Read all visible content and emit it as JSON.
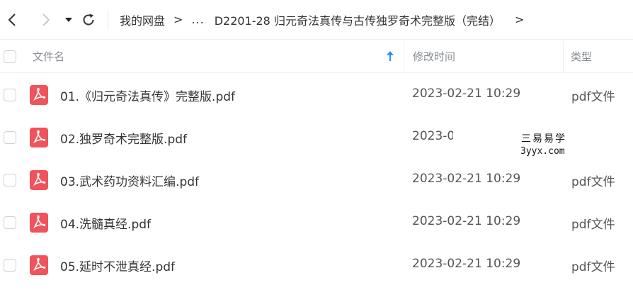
{
  "navbar": {
    "breadcrumb": {
      "root": "我的网盘",
      "separator": ">",
      "ellipsis": "...",
      "current": "D2201-28 归元奇法真传与古传独罗奇术完整版（完结）"
    },
    "icons": [
      "chevron-left-icon",
      "chevron-right-icon",
      "caret-down-icon",
      "refresh-icon"
    ]
  },
  "header": {
    "name": "文件名",
    "time": "修改时间",
    "type": "类型",
    "sort_icon": "arrow-up-icon"
  },
  "files": [
    {
      "name": "01.《归元奇法真传》完整版.pdf",
      "time": "2023-02-21 10:29",
      "type": "pdf文件"
    },
    {
      "name": "02.独罗奇术完整版.pdf",
      "time": "2023-0",
      "type": ""
    },
    {
      "name": "03.武术药功资料汇编.pdf",
      "time": "2023-02-21 10:29",
      "type": "pdf文件"
    },
    {
      "name": "04.洗髓真经.pdf",
      "time": "2023-02-21 10:29",
      "type": "pdf文件"
    },
    {
      "name": "05.延时不泄真经.pdf",
      "time": "2023-02-21 10:29",
      "type": "pdf文件"
    }
  ],
  "watermark": {
    "line1": "三易易学",
    "line2": "3yyx.com"
  },
  "colors": {
    "pdf_icon": "#f0535b",
    "sort_arrow": "#2b8cf3",
    "text": "#333333",
    "muted": "#878c93"
  }
}
